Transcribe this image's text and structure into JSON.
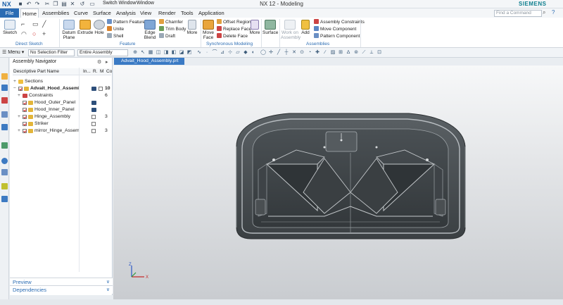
{
  "title_bar": {
    "app_logo": "NX",
    "switch_window": "Switch Window",
    "window_menu": "Window",
    "title": "NX 12 - Modeling",
    "brand": "SIEMENS"
  },
  "tabs": [
    "File",
    "Home",
    "Assemblies",
    "Curve",
    "Surface",
    "Analysis",
    "View",
    "Render",
    "Tools",
    "Application"
  ],
  "active_tab": "Home",
  "search": {
    "placeholder": "Find a Command"
  },
  "ribbon": {
    "direct_sketch": {
      "label": "Direct Sketch",
      "sketch": "Sketch"
    },
    "feature": {
      "label": "Feature",
      "datum_plane": "Datum Plane",
      "extrude": "Extrude",
      "hole": "Hole",
      "pattern_feature": "Pattern Feature",
      "unite": "Unite",
      "shell": "Shell",
      "edge_blend": "Edge Blend",
      "chamfer": "Chamfer",
      "trim_body": "Trim Body",
      "draft": "Draft",
      "more": "More"
    },
    "synchronous": {
      "label": "Synchronous Modeling",
      "move_face": "Move Face",
      "offset_region": "Offset Region",
      "replace_face": "Replace Face",
      "delete_face": "Delete Face",
      "more": "More"
    },
    "surface": "Surface",
    "assemblies": {
      "label": "Assemblies",
      "work_on_assembly": "Work on Assembly",
      "add": "Add",
      "assembly_constraints": "Assembly Constraints",
      "move_component": "Move Component",
      "pattern_component": "Pattern Component"
    }
  },
  "selection_bar": {
    "menu": "Menu",
    "filter": "No Selection Filter",
    "scope": "Entire Assembly"
  },
  "navigator": {
    "title": "Assembly Navigator",
    "columns": [
      "Descriptive Part Name",
      "In...",
      "R.",
      "M",
      "Co"
    ],
    "rows": [
      {
        "name": "Sections",
        "level": 0,
        "expander": "+",
        "checked": false,
        "count": ""
      },
      {
        "name": "Advait_Hood_Assembl...",
        "level": 0,
        "expander": "−",
        "checked": true,
        "count": "10",
        "bold": true
      },
      {
        "name": "Constraints",
        "level": 1,
        "expander": "+",
        "checked": false,
        "count": "6"
      },
      {
        "name": "Hood_Outer_Panel",
        "level": 1,
        "expander": "",
        "checked": true,
        "count": ""
      },
      {
        "name": "Hood_Inner_Panel",
        "level": 1,
        "expander": "",
        "checked": true,
        "count": ""
      },
      {
        "name": "Hinge_Assembly",
        "level": 1,
        "expander": "+",
        "checked": true,
        "count": "3"
      },
      {
        "name": "Striker",
        "level": 1,
        "expander": "",
        "checked": true,
        "count": ""
      },
      {
        "name": "mirror_Hinge_Assem...",
        "level": 1,
        "expander": "+",
        "checked": true,
        "count": "3"
      }
    ],
    "preview": "Preview",
    "dependencies": "Dependencies"
  },
  "graphics_tab": "Advait_Hood_Assembly.prt",
  "colors": {
    "accent": "#2b6cb3",
    "brand": "#0f7f8f",
    "part": "#3f4548"
  }
}
